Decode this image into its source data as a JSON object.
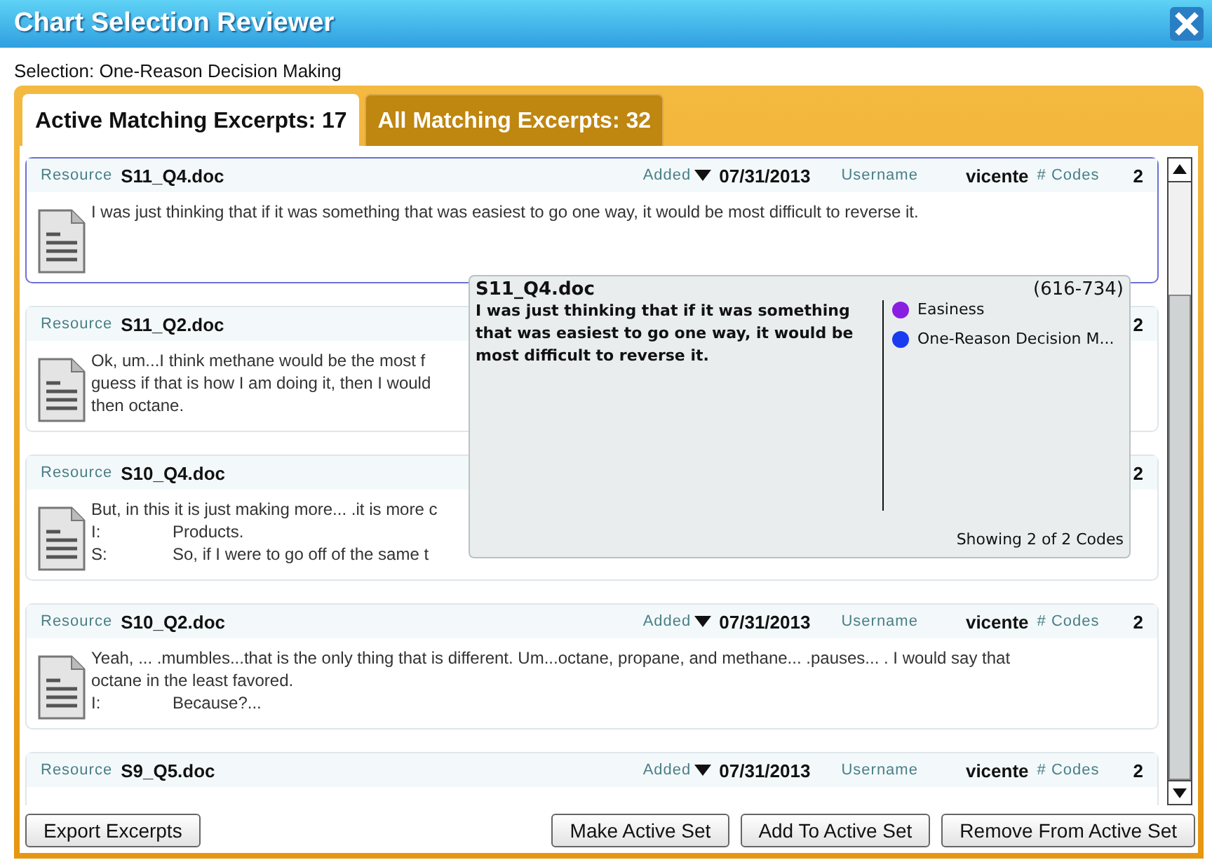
{
  "window": {
    "title": "Chart Selection Reviewer"
  },
  "selection": "Selection: One-Reason Decision Making",
  "tabs": [
    {
      "label": "Active Matching Excerpts: 17",
      "selected": true
    },
    {
      "label": "All Matching Excerpts: 32",
      "selected": false
    }
  ],
  "excerpts": [
    {
      "resource_label": "Resource",
      "resource": "S11_Q4.doc",
      "selected": true,
      "added_label": "Added",
      "date": "07/31/2013",
      "username_label": "Username",
      "username": "vicente",
      "codes_label": "# Codes",
      "codes": "2",
      "lines": [
        {
          "text": "I was just thinking that if it was something that was easiest to go one way, it would be most difficult to reverse it."
        }
      ]
    },
    {
      "resource_label": "Resource",
      "resource": "S11_Q2.doc",
      "selected": false,
      "codes": "2",
      "lines": [
        {
          "text": "Ok, um...I think methane would be the most f"
        },
        {
          "text": "guess if that is how I am doing it, then I would"
        },
        {
          "text": "then octane."
        }
      ]
    },
    {
      "resource_label": "Resource",
      "resource": "S10_Q4.doc",
      "selected": false,
      "codes": "2",
      "lines": [
        {
          "text": "But, in this it is just making more... .it is more c"
        },
        {
          "speaker": "I:",
          "text": "Products."
        },
        {
          "speaker": "S:",
          "text": "So, if I were to go off of the same t"
        }
      ]
    },
    {
      "resource_label": "Resource",
      "resource": "S10_Q2.doc",
      "selected": false,
      "added_label": "Added",
      "date": "07/31/2013",
      "username_label": "Username",
      "username": "vicente",
      "codes_label": "# Codes",
      "codes": "2",
      "lines": [
        {
          "text": "Yeah, ... .mumbles...that is the only thing that is different. Um...octane, propane, and methane... .pauses... . I would say that"
        },
        {
          "text": "octane in the least favored."
        },
        {
          "speaker": "I:",
          "text": "Because?..."
        }
      ]
    },
    {
      "resource_label": "Resource",
      "resource": "S9_Q5.doc",
      "selected": false,
      "added_label": "Added",
      "date": "07/31/2013",
      "username_label": "Username",
      "username": "vicente",
      "codes_label": "# Codes",
      "codes": "2"
    }
  ],
  "tooltip": {
    "resource": "S11_Q4.doc",
    "range": "(616-734)",
    "text": "I was just thinking that if it was something that was easiest to go one way, it would be most difficult to reverse it.",
    "codes": [
      {
        "name": "Easiness",
        "color": "#8a1ee0"
      },
      {
        "name": "One-Reason Decision M...",
        "color": "#1a3cf0"
      }
    ],
    "footer": "Showing 2 of 2 Codes"
  },
  "buttons_left": [
    "Export Excerpts"
  ],
  "buttons_right": [
    "Make Active Set",
    "Add To Active Set",
    "Remove From Active Set"
  ]
}
